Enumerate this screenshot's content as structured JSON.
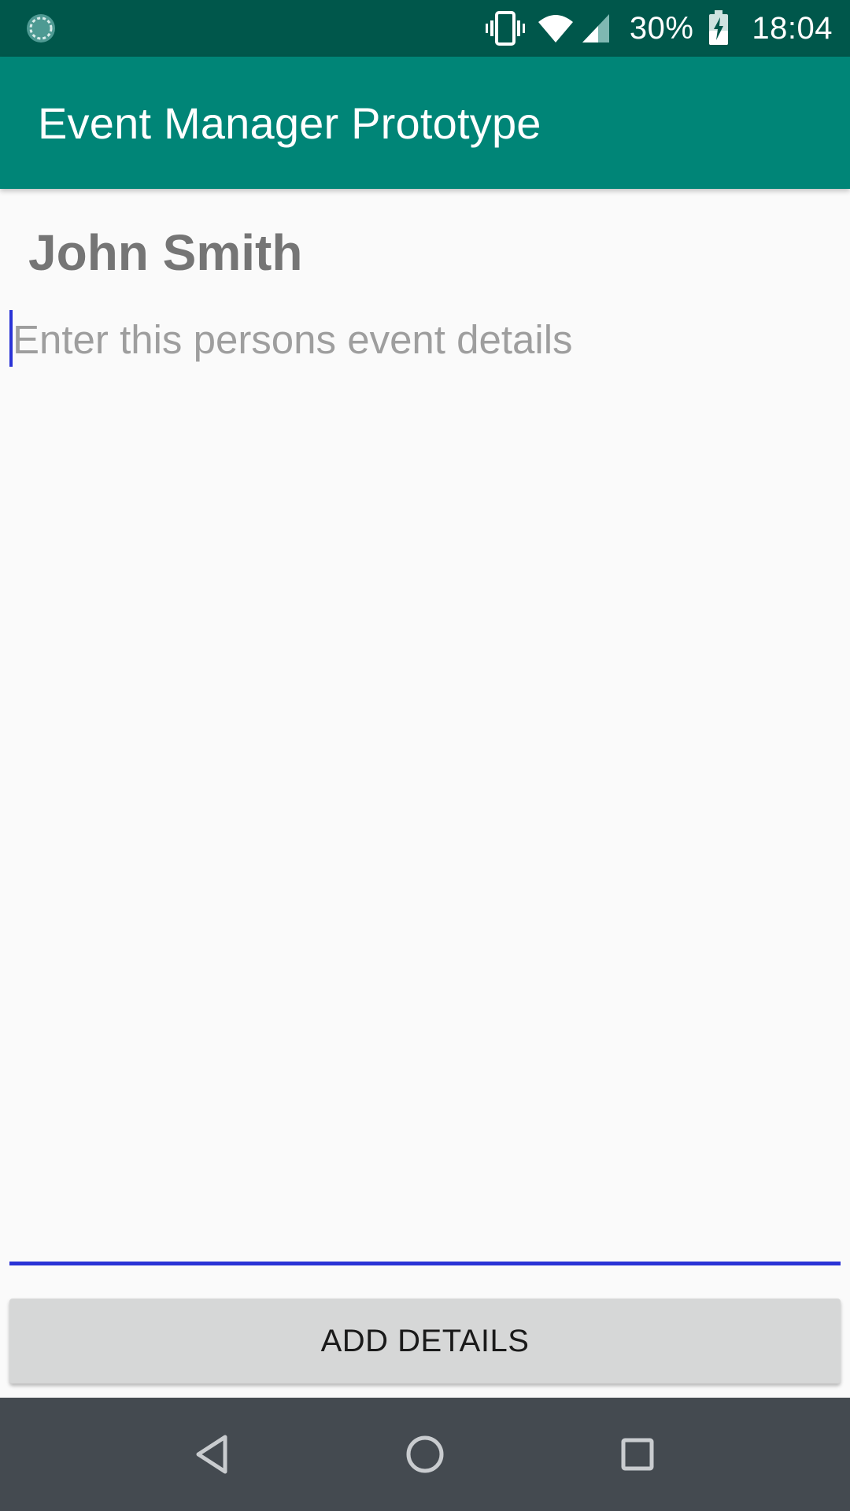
{
  "status_bar": {
    "battery_percent": "30%",
    "time": "18:04",
    "icons": [
      "sync-icon",
      "vibrate-icon",
      "wifi-icon",
      "signal-icon",
      "battery-charging-icon"
    ]
  },
  "app_bar": {
    "title": "Event Manager Prototype"
  },
  "main": {
    "person_name": "John Smith",
    "details_input": {
      "value": "",
      "placeholder": "Enter this persons event details"
    },
    "add_button_label": "ADD DETAILS"
  },
  "nav_bar": {
    "buttons": [
      "back-icon",
      "home-icon",
      "recents-icon"
    ]
  },
  "colors": {
    "status_bar": "#00574b",
    "app_bar": "#008577",
    "accent": "#2a33d6",
    "background": "#fafafa",
    "button": "#d6d7d7",
    "nav_bar": "#444a50"
  }
}
